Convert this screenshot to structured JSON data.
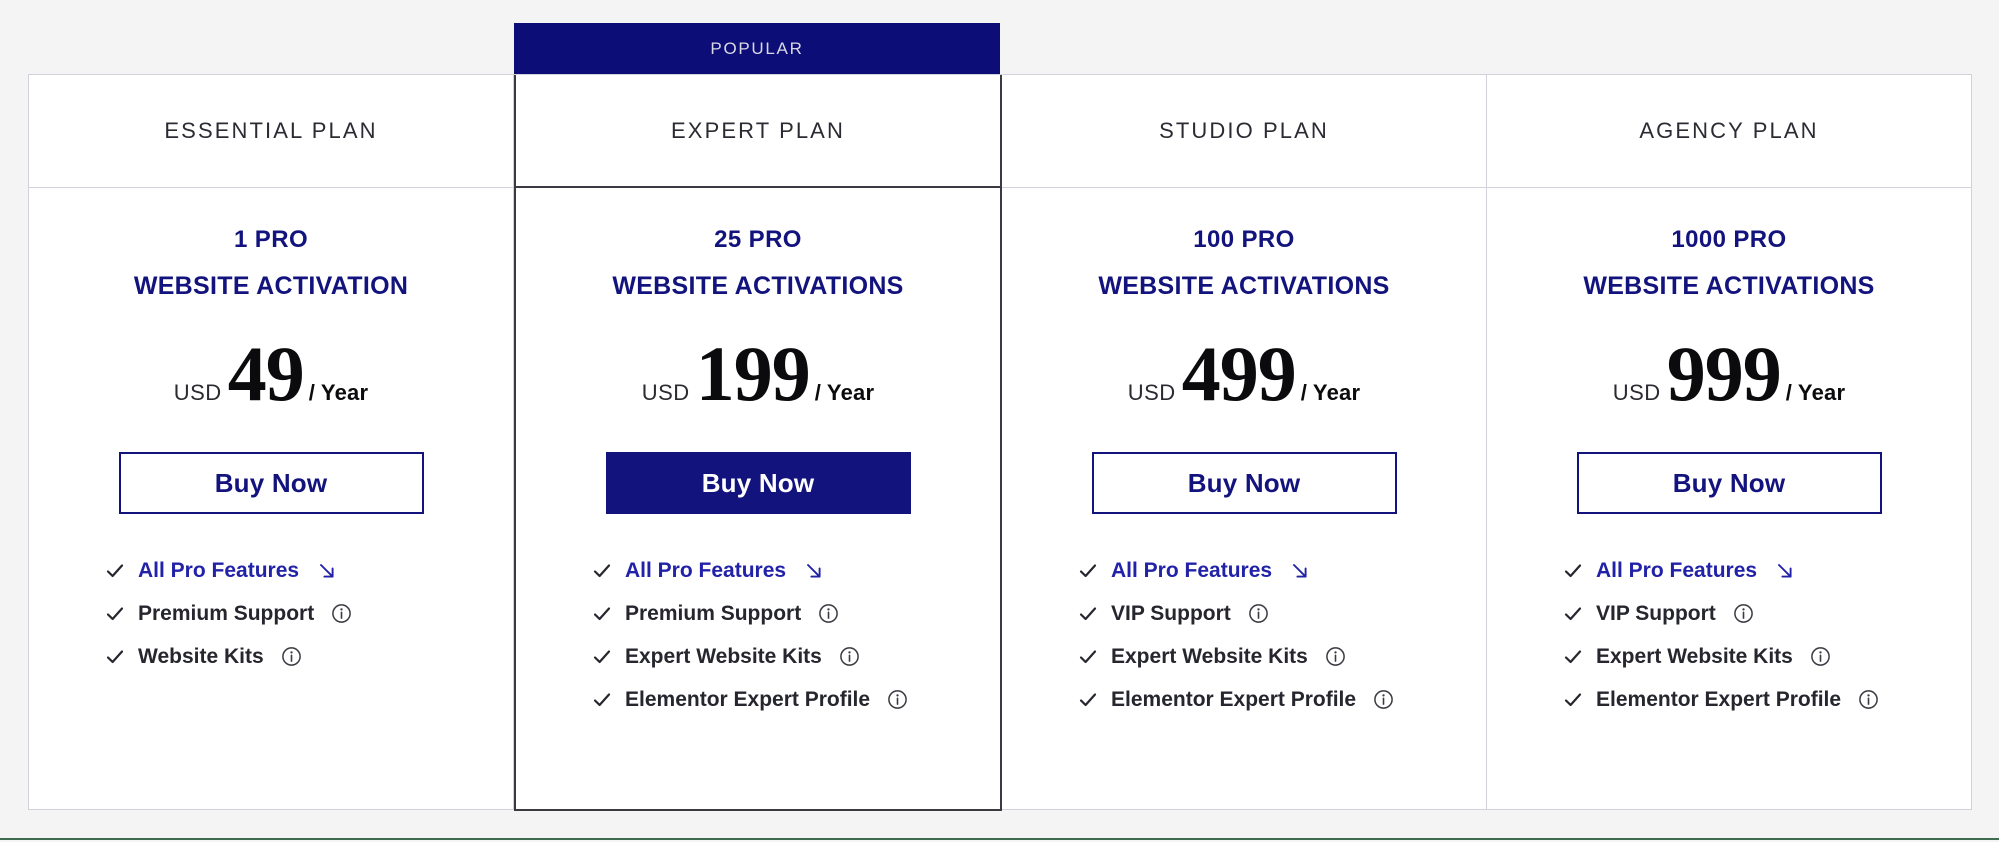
{
  "page": {
    "background_color": "#f4f4f5",
    "accent_color": "#13137e",
    "highlight_border_color": "#3a3a42",
    "bottom_rule_color": "#3f6b4f"
  },
  "ribbon": {
    "popular_label": "POPULAR",
    "popular_column_index": 1,
    "background_color": "#0d0d78",
    "text_color": "#d9d9e4"
  },
  "plans": [
    {
      "name": "ESSENTIAL PLAN",
      "popular": false,
      "activation_count": "1 PRO",
      "activation_label": "WEBSITE ACTIVATION",
      "currency": "USD",
      "amount": "49",
      "period": "/ Year",
      "cta_label": "Buy Now",
      "cta_style": "outline",
      "features": [
        {
          "label": "All Pro Features",
          "icon": "arrow-down-right-icon",
          "highlight": true
        },
        {
          "label": "Premium Support",
          "icon": "info-icon",
          "highlight": false
        },
        {
          "label": "Website Kits",
          "icon": "info-icon",
          "highlight": false
        }
      ]
    },
    {
      "name": "EXPERT PLAN",
      "popular": true,
      "activation_count": "25 PRO",
      "activation_label": "WEBSITE ACTIVATIONS",
      "currency": "USD",
      "amount": "199",
      "period": "/ Year",
      "cta_label": "Buy Now",
      "cta_style": "filled",
      "features": [
        {
          "label": "All Pro Features",
          "icon": "arrow-down-right-icon",
          "highlight": true
        },
        {
          "label": "Premium Support",
          "icon": "info-icon",
          "highlight": false
        },
        {
          "label": "Expert Website Kits",
          "icon": "info-icon",
          "highlight": false
        },
        {
          "label": "Elementor Expert Profile",
          "icon": "info-icon",
          "highlight": false
        }
      ]
    },
    {
      "name": "STUDIO PLAN",
      "popular": false,
      "activation_count": "100 PRO",
      "activation_label": "WEBSITE ACTIVATIONS",
      "currency": "USD",
      "amount": "499",
      "period": "/ Year",
      "cta_label": "Buy Now",
      "cta_style": "outline",
      "features": [
        {
          "label": "All Pro Features",
          "icon": "arrow-down-right-icon",
          "highlight": true
        },
        {
          "label": "VIP Support",
          "icon": "info-icon",
          "highlight": false
        },
        {
          "label": "Expert Website Kits",
          "icon": "info-icon",
          "highlight": false
        },
        {
          "label": "Elementor Expert Profile",
          "icon": "info-icon",
          "highlight": false
        }
      ]
    },
    {
      "name": "AGENCY PLAN",
      "popular": false,
      "activation_count": "1000 PRO",
      "activation_label": "WEBSITE ACTIVATIONS",
      "currency": "USD",
      "amount": "999",
      "period": "/ Year",
      "cta_label": "Buy Now",
      "cta_style": "outline",
      "features": [
        {
          "label": "All Pro Features",
          "icon": "arrow-down-right-icon",
          "highlight": true
        },
        {
          "label": "VIP Support",
          "icon": "info-icon",
          "highlight": false
        },
        {
          "label": "Expert Website Kits",
          "icon": "info-icon",
          "highlight": false
        },
        {
          "label": "Elementor Expert Profile",
          "icon": "info-icon",
          "highlight": false
        }
      ]
    }
  ]
}
